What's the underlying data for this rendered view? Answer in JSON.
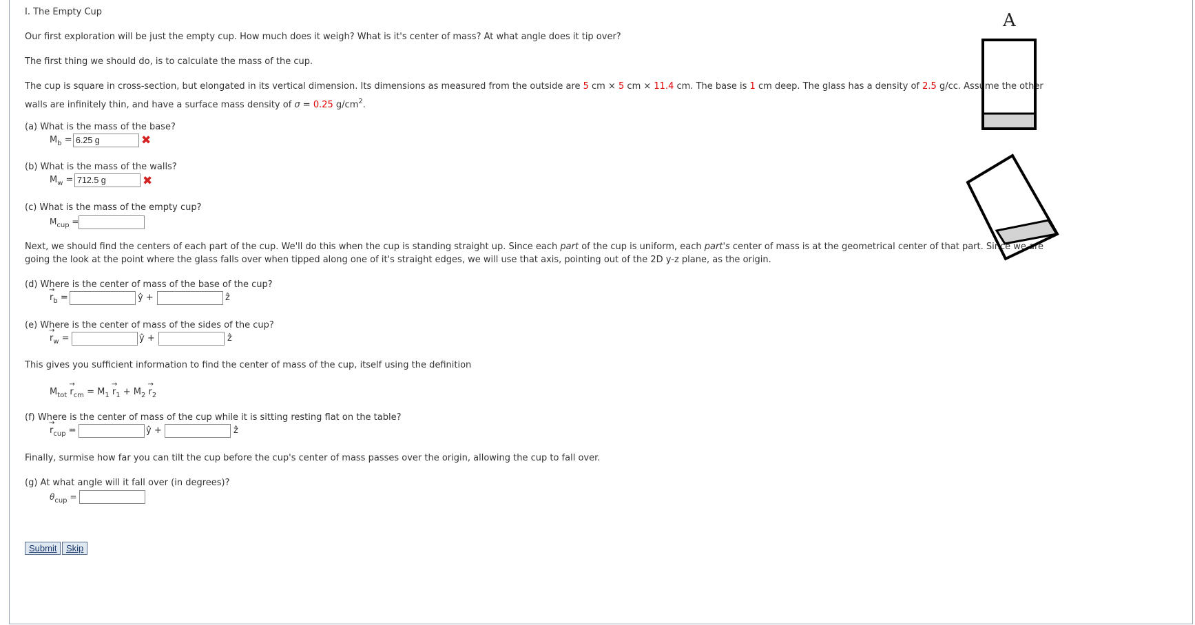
{
  "section_title": "I. The Empty Cup",
  "intro": "Our first exploration will be just the empty cup. How much does it weigh? What is it's center of mass? At what angle does it tip over?",
  "first_step": "The first thing we should do, is to calculate the mass of the cup.",
  "desc": {
    "p1": "The cup is square in cross-section, but elongated in its vertical dimension. Its dimensions as measured from the outside are ",
    "d1": "5",
    "p2": " cm × ",
    "d2": "5",
    "p3": " cm × ",
    "d3": "11.4",
    "p4": " cm. The base is ",
    "d4": "1",
    "p5": " cm deep. The glass has a density of ",
    "d5": "2.5",
    "p6": " g/cc. Assume the other",
    "line2_a": "walls are infinitely thin, and have a surface mass density of ",
    "sigma": "σ",
    "eq": " = ",
    "d6": "0.25",
    "unit": " g/cm",
    "unit_exp": "2",
    "period": "."
  },
  "q_a": {
    "text": "(a) What is the mass of the base?",
    "sym": "M",
    "sub": "b",
    "eq": " =",
    "value": "6.25 g",
    "status": "✖"
  },
  "q_b": {
    "text": "(b) What is the mass of the walls?",
    "sym": "M",
    "sub": "w",
    "eq": " =",
    "value": "712.5 g",
    "status": "✖"
  },
  "q_c": {
    "text": "(c) What is the mass of the empty cup?",
    "sym": "M",
    "sub": "cup",
    "eq": " =",
    "value": ""
  },
  "centers": {
    "l1a": "Next, we should find the centers of each part of the cup. We'll do this when the cup is standing straight up. Since each ",
    "l1b": "part",
    "l1c": " of the cup is uniform, each ",
    "l1d": "part's",
    "l1e": " center of mass is at the geometrical center of that part. Since we are",
    "l2": "going the look at the point where the glass falls over when tipped along one of it's straight edges, we will use that axis, pointing out of the 2D y-z plane, as the origin."
  },
  "q_d": {
    "text": "(d) Where is the center of mass of the base of the cup?",
    "sym": "r",
    "sub": "b",
    "eq": " =",
    "y": "ŷ +",
    "z": "ẑ",
    "value_y": "",
    "value_z": ""
  },
  "q_e": {
    "text": "(e) Where is the center of mass of the sides of the cup?",
    "sym": "r",
    "sub": "w",
    "eq": " =",
    "y": "ŷ +",
    "z": "ẑ",
    "value_y": "",
    "value_z": ""
  },
  "info": "This gives you sufficient information to find the center of mass of the cup, itself using the definition",
  "formula": {
    "M": "M",
    "tot": "tot",
    "r": "r",
    "cm": "cm",
    "eq": " = M",
    "one": "1",
    "r1": "r",
    "r1sub": "1",
    "plus": " + M",
    "two": "2",
    "r2": "r",
    "r2sub": "2"
  },
  "q_f": {
    "text": "(f) Where is the center of mass of the cup while it is sitting resting flat on the table?",
    "sym": "r",
    "sub": "cup",
    "eq": " =",
    "y": "ŷ +",
    "z": "ẑ",
    "value_y": "",
    "value_z": ""
  },
  "finally": "Finally, surmise how far you can tilt the cup before the cup's center of mass passes over the origin, allowing the cup to fall over.",
  "q_g": {
    "text": "(g) At what angle will it fall over (in degrees)?",
    "sym": "θ",
    "sub": "cup",
    "eq": " =",
    "value": ""
  },
  "buttons": {
    "submit": "Submit",
    "skip": "Skip"
  },
  "figure": {
    "label": "A",
    "fill_color": "#d3d3d3",
    "stroke_color": "#000000"
  }
}
